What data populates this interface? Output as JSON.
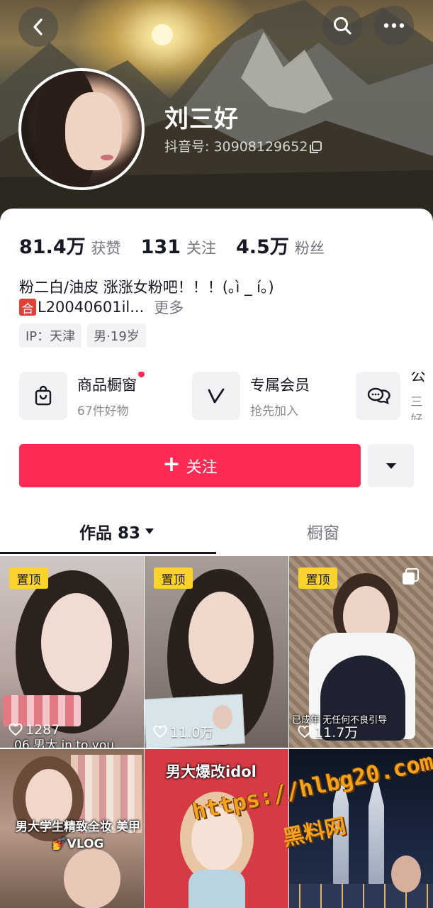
{
  "header": {
    "username": "刘三好",
    "douyin_id": "抖音号: 30908129652"
  },
  "stats": [
    {
      "value": "81.4万",
      "label": "获赞"
    },
    {
      "value": "131",
      "label": "关注"
    },
    {
      "value": "4.5万",
      "label": "粉丝"
    }
  ],
  "bio": {
    "line1": "粉二白/油皮 涨涨女粉吧！！！(｡ì _ í｡)",
    "badge": "合",
    "line2": "L20040601il...",
    "more": "更多"
  },
  "tags": [
    "IP：天津",
    "男·19岁"
  ],
  "entries": [
    {
      "title": "商品橱窗",
      "sub": "67件好物",
      "icon": "shopping-bag-icon"
    },
    {
      "title": "专属会员",
      "sub": "抢先加入",
      "icon": "v-member-icon"
    },
    {
      "title": "公",
      "sub": "三好",
      "icon": "chat-bubbles-icon"
    }
  ],
  "follow_label": "关注",
  "tabs": {
    "works": "作品 83",
    "window": "橱窗"
  },
  "grid": {
    "pin_label": "置顶",
    "items": [
      {
        "likes": "1287",
        "caption": "06 男大 in to you"
      },
      {
        "likes": "11.0万",
        "caption": ""
      },
      {
        "likes": "11.7万",
        "caption": "已成年 无任何不良引导"
      },
      {
        "caption": "男大学生精致全妆 美甲💅VLOG"
      },
      {
        "caption": "男大爆改idol"
      },
      {
        "caption": ""
      }
    ]
  },
  "watermark": {
    "url": "https://hlbg20.com",
    "name": "黑料网"
  },
  "colors": {
    "accent": "#fe2c55",
    "pin": "#fcd22c",
    "text": "#161823",
    "secondary": "#75767d"
  }
}
